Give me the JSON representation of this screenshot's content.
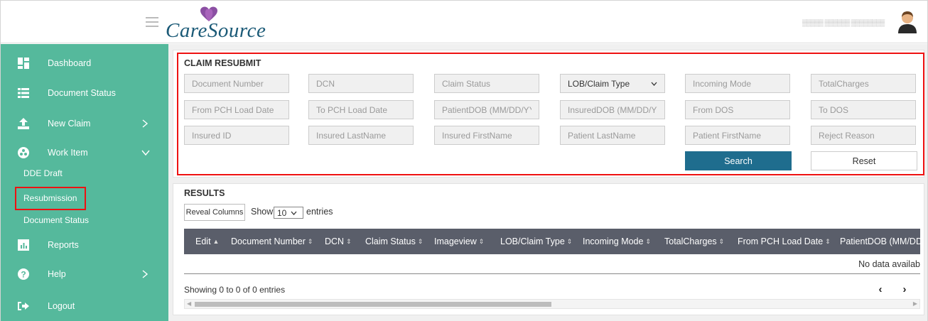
{
  "header": {
    "brand": "CareSource",
    "user_name": "▒▒▒▒▒ ▒▒▒▒▒▒ ▒▒▒▒▒▒▒▒"
  },
  "sidebar": {
    "items": [
      {
        "label": "Dashboard",
        "icon": "dashboard-grid-icon"
      },
      {
        "label": "Document Status",
        "icon": "list-icon"
      },
      {
        "label": "New Claim",
        "icon": "upload-icon",
        "chevron": "right"
      },
      {
        "label": "Work Item",
        "icon": "network-icon",
        "chevron": "down"
      },
      {
        "label": "Reports",
        "icon": "bar-chart-icon"
      },
      {
        "label": "Help",
        "icon": "question-icon",
        "chevron": "right"
      },
      {
        "label": "Logout",
        "icon": "logout-icon"
      }
    ],
    "sub_items": [
      "DDE Draft",
      "Resubmission",
      "Document Status"
    ],
    "active_sub_item": "Resubmission"
  },
  "search": {
    "title": "CLAIM RESUBMIT",
    "fields": [
      "Document Number",
      "DCN",
      "Claim Status",
      "LOB/Claim Type",
      "Incoming Mode",
      "TotalCharges",
      "From PCH Load Date",
      "To PCH Load Date",
      "PatientDOB (MM/DD/YYYY)",
      "InsuredDOB (MM/DD/YYYY)",
      "From DOS",
      "To DOS",
      "Insured ID",
      "Insured LastName",
      "Insured FirstName",
      "Patient LastName",
      "Patient FirstName",
      "Reject Reason"
    ],
    "lob_select_value": "LOB/Claim Type",
    "search_label": "Search",
    "reset_label": "Reset"
  },
  "results": {
    "title": "RESULTS",
    "reveal_columns_label": "Reveal Columns",
    "show_label": "Show",
    "entries_value": "10",
    "entries_label": "entries",
    "columns": [
      {
        "label": "Edit",
        "sort": "▲"
      },
      {
        "label": "Document Number",
        "sort": "⇕"
      },
      {
        "label": "DCN",
        "sort": "⇕"
      },
      {
        "label": "Claim Status",
        "sort": "⇕"
      },
      {
        "label": "Imageview",
        "sort": "⇕"
      },
      {
        "label": "LOB/Claim Type",
        "sort": "⇕"
      },
      {
        "label": "Incoming Mode",
        "sort": "⇕"
      },
      {
        "label": "TotalCharges",
        "sort": "⇕"
      },
      {
        "label": "From PCH Load Date",
        "sort": "⇕"
      },
      {
        "label": "PatientDOB (MM/DD",
        "sort": ""
      }
    ],
    "empty_message": "No data availab",
    "info": "Showing 0 to 0 of 0 entries",
    "prev_label": "‹",
    "next_label": "›"
  },
  "colors": {
    "sidebar": "#55b99c",
    "primary_button": "#1f6d8e",
    "table_header": "#5a5e6a",
    "highlight": "#ee1111"
  }
}
